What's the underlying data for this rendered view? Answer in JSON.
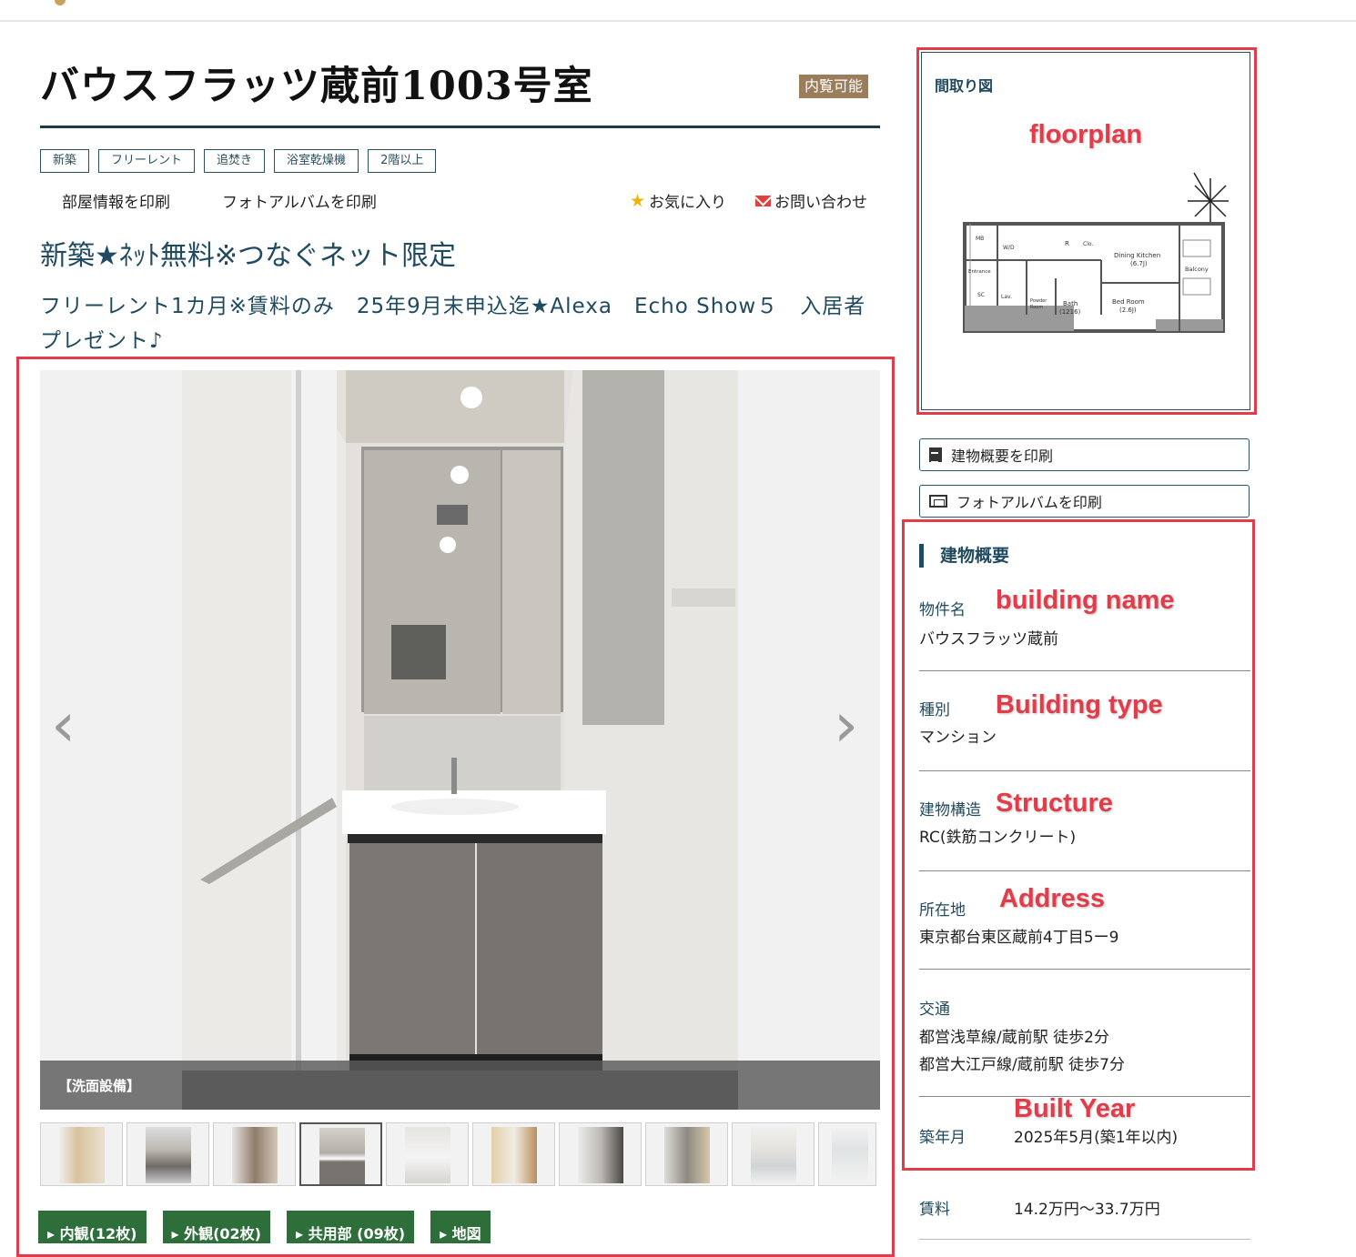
{
  "header": {
    "title": "バウスフラッツ蔵前1003号室",
    "viewing_badge": "内覧可能"
  },
  "tags": [
    "新築",
    "フリーレント",
    "追焚き",
    "浴室乾燥機",
    "2階以上"
  ],
  "links": {
    "print_room": "部屋情報を印刷",
    "print_album": "フォトアルバムを印刷",
    "favorite": "お気に入り",
    "contact": "お問い合わせ"
  },
  "catchcopy": {
    "line1": "新築★ﾈｯﾄ無料※つなぐネット限定",
    "line2": "フリーレント1カ月※賃料のみ　25年9月末申込迄★Alexa　Echo Show５　入居者プレゼント♪"
  },
  "gallery": {
    "caption": "【洗面設備】",
    "prev_arrow": "‹",
    "next_arrow": "›",
    "thumbs": [
      "thumb-1",
      "thumb-2",
      "thumb-3",
      "thumb-4",
      "thumb-5",
      "thumb-6",
      "thumb-7",
      "thumb-8",
      "thumb-9",
      "thumb-10"
    ],
    "selected_thumb": 4,
    "tabs": [
      "▸ 内観(12枚)",
      "▸ 外観(02枚)",
      "▸ 共用部 (09枚)",
      "▸ 地図"
    ]
  },
  "floorplan": {
    "title": "間取り図",
    "annotation": "floorplan",
    "room_labels": {
      "mb": "MB",
      "wd": "W/D",
      "r": "R",
      "clo": "Clo.",
      "dining_kitchen": "Dining Kitchen",
      "dining_size": "(6.7J)",
      "balcony": "Balcony",
      "entrance": "Entrance",
      "sc": "SC",
      "lav": "Lav.",
      "powder": "Powder",
      "room": "Room",
      "bath": "Bath",
      "bath_size": "(1216)",
      "bedroom": "Bed Room",
      "bedroom_size": "(2.6J)"
    }
  },
  "side_buttons": {
    "print_overview": "建物概要を印刷",
    "print_album": "フォトアルバムを印刷"
  },
  "overview": {
    "title": "建物概要",
    "fields": [
      {
        "label": "物件名",
        "value": "バウスフラッツ蔵前",
        "annotation": "building name"
      },
      {
        "label": "種別",
        "value": "マンション",
        "annotation": "Building type"
      },
      {
        "label": "建物構造",
        "value": "RC(鉄筋コンクリート)",
        "annotation": "Structure"
      },
      {
        "label": "所在地",
        "value": "東京都台東区蔵前4丁目5ー9",
        "annotation": "Address"
      },
      {
        "label": "交通",
        "value": "都営浅草線/蔵前駅 徒歩2分",
        "value2": "都営大江戸線/蔵前駅 徒歩7分"
      },
      {
        "label": "築年月",
        "value": "2025年5月(築1年以内)",
        "annotation": "Built Year"
      }
    ],
    "rent_label": "賃料",
    "rent_value": "14.2万円〜33.7万円"
  },
  "colors": {
    "accent": "#1f4a5f",
    "annotation_red": "#e23b4a",
    "tab_green": "#2e6e3b",
    "badge": "#9b7d5b"
  }
}
